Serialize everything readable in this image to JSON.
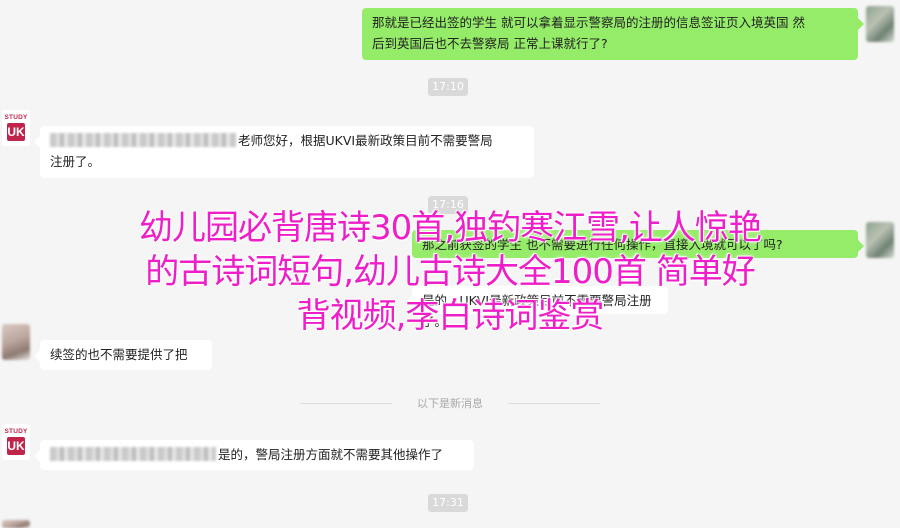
{
  "messages": [
    {
      "side": "out",
      "lines": [
        "那就是已经出签的学生 就可以拿着显示警察局的注册的信息签证页入境英国 然",
        "后到英国后也不去警察局 正常上课就行了?"
      ]
    },
    {
      "side": "in",
      "lines": [
        "老师您好，根据UKVI最新政策目前不需要警局",
        "注册了。"
      ]
    },
    {
      "side": "out",
      "lines": [
        "那之前获签的学生 也不需要进行任何操作，直接入境就可以了吗?"
      ]
    },
    {
      "side": "in",
      "lines": [
        "是的，UKVI最新政策目前不需要警局注册了。"
      ]
    },
    {
      "side": "in",
      "lines": [
        "续签的也不需要提供了把"
      ]
    },
    {
      "side": "in",
      "lines": [
        "是的，警局注册方面就不需要其他操作了"
      ]
    }
  ],
  "times": [
    "17:10",
    "17:16",
    "17:31"
  ],
  "divider": "以下是新消息",
  "avatar_logo": {
    "line1": "STUDY",
    "line2": "UK"
  },
  "overlay": {
    "line1": "幼儿园必背唐诗30首,独钓寒江雪,让人惊艳",
    "line2": "的古诗词短句,幼儿古诗大全100首 简单好",
    "line3": "背视频,李白诗词鉴赏"
  },
  "colors": {
    "background": "#f5f5f5",
    "out_bubble": "#95ec69",
    "in_bubble": "#ffffff",
    "overlay_text": "#ee1ec8"
  }
}
